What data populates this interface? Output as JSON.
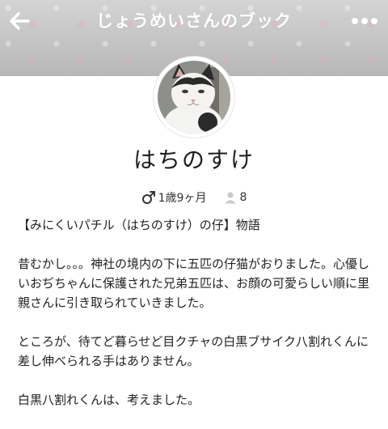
{
  "header": {
    "title": "じょうめいさんのブック",
    "back_icon": "back-arrow-icon",
    "more_icon": "more-dots-icon"
  },
  "profile": {
    "name": "はちのすけ",
    "gender_icon": "male-icon",
    "age": "1歳9ヶ月",
    "followers_icon": "person-icon",
    "followers": "8"
  },
  "content": {
    "intro": "【みにくいパチル（はちのすけ）の仔】物語",
    "paragraphs": [
      "昔むかし。。。神社の境内の下に五匹の仔猫がおりました。心優しいおぢちゃんに保護された兄弟五匹は、お顔の可愛らしい順に里親さんに引き取られていきました。",
      "ところが、待てど暮らせど目クチャの白黒ブサイク八割れくんに差し伸べられる手はありません。",
      "白黒八割れくんは、考えました。"
    ]
  },
  "colors": {
    "header_bg": "#c4c4c4",
    "title_text": "#ffffff",
    "accent": "#ffffff"
  }
}
